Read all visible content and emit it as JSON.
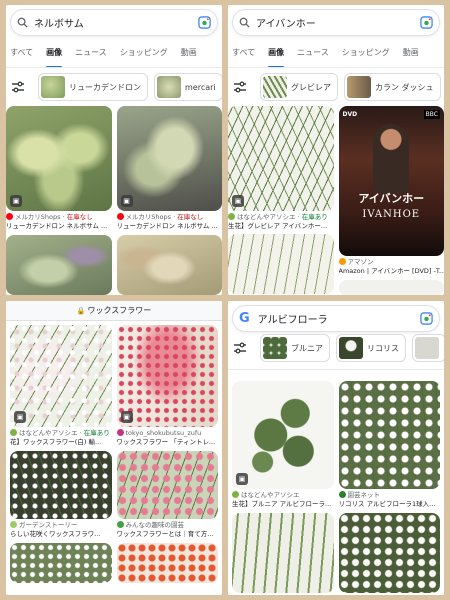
{
  "tabs": [
    "すべて",
    "画像",
    "ニュース",
    "ショッピング",
    "動画"
  ],
  "panel1": {
    "query": "ネルボサム",
    "chips": [
      "リューカデンドロン",
      "mercari"
    ],
    "results": [
      {
        "source": "メルカリShops",
        "stock": "在庫なし",
        "title": "リューカデンドロン ネルボサム ..."
      },
      {
        "source": "メルカリShops",
        "stock": "在庫なし",
        "title": "リューカデンドロン ネルボサム ..."
      },
      {
        "source": "",
        "stock": "",
        "title": ""
      },
      {
        "source": "",
        "stock": "",
        "title": ""
      }
    ]
  },
  "panel2": {
    "query": "アイバンホー",
    "chips": [
      "グレビレア",
      "カラン ダッシュ"
    ],
    "results": [
      {
        "source": "はなどんやアソシエ",
        "stock": "在庫あり",
        "title": "生花】グレビレア アイバンホー..."
      },
      {
        "source": "アマゾン",
        "stock": "",
        "title": "Amazon | アイバンホー [DVD] -T..."
      },
      {
        "source": "",
        "stock": "",
        "title": ""
      },
      {
        "source": "",
        "stock": "",
        "title": ""
      }
    ],
    "dvd": {
      "jp_title": "アイバンホー",
      "en_title": "IVANHOE",
      "logo_left": "DVD",
      "logo_right": "BBC"
    }
  },
  "panel3": {
    "url": "ワックスフラワー",
    "results": [
      {
        "source": "はなどんやアソシエ",
        "stock": "在庫あり",
        "title": "花】ワックスフラワー(白) 輸..."
      },
      {
        "source": "tokyo_shokubutsu_zufu",
        "stock": "",
        "title": "ワックスフラワー 「ティントレ..."
      },
      {
        "source": "ガーデンストーリー",
        "stock": "",
        "title": "らしい花咲くワックスフラワ..."
      },
      {
        "source": "みんなの趣味の園芸",
        "stock": "",
        "title": "ワックスフラワーとは｜育て方..."
      },
      {
        "source": "",
        "stock": "",
        "title": ""
      },
      {
        "source": "",
        "stock": "",
        "title": ""
      }
    ]
  },
  "panel4": {
    "query": "アルビフローラ",
    "chips": [
      "ブルニア",
      "リコリス"
    ],
    "results": [
      {
        "source": "はなどんやアソシエ",
        "stock": "",
        "title": "生花】ブルニア アルビフローラ..."
      },
      {
        "source": "園芸ネット",
        "stock": "",
        "title": "リコリス アルビフローラ1球入..."
      },
      {
        "source": "",
        "stock": "",
        "title": ""
      },
      {
        "source": "",
        "stock": "",
        "title": ""
      }
    ]
  },
  "icons": {
    "search": "search-icon",
    "lens": "google-lens-icon",
    "filter": "filter-sliders-icon",
    "google": "google-logo",
    "lock": "lock-icon",
    "image_badge": "image-badge-icon"
  }
}
